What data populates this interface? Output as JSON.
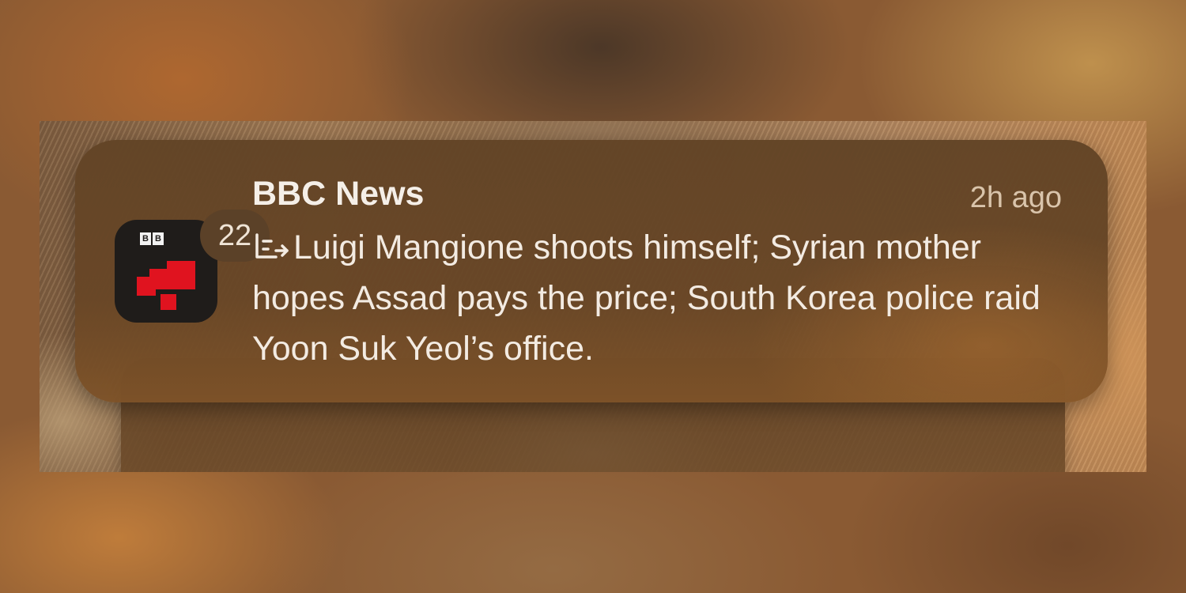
{
  "notification": {
    "app_name": "BBC News",
    "time": "2h ago",
    "badge_count": "22",
    "icon_letters": [
      "B",
      "B"
    ],
    "icon_glyph": "summary-icon",
    "message": "Luigi Mangione shoots himself; Syrian mother hopes Assad pays the price; South Korea police raid Yoon Suk Yeol’s office."
  },
  "colors": {
    "icon_red": "#e0131f",
    "icon_background": "#1f1c1a",
    "card_background": "#62442a"
  }
}
